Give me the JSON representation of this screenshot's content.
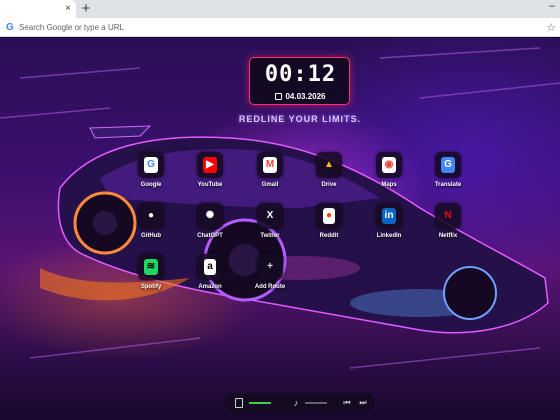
{
  "browser": {
    "tab_close": "×",
    "new_tab": "+",
    "window_minimize": "–",
    "omnibox_placeholder": "Search Google or type a URL",
    "google_g": "G",
    "bookmark_star": "☆"
  },
  "clock": {
    "time": "00:12",
    "date": "04.03.2026"
  },
  "tagline": "REDLINE YOUR LIMITS.",
  "shortcuts": [
    {
      "label": "Google",
      "glyph": "G",
      "icon": "google-icon",
      "color": "#4285f4",
      "bg": "#ffffff"
    },
    {
      "label": "YouTube",
      "glyph": "▶",
      "icon": "youtube-icon",
      "color": "#ffffff",
      "bg": "#ff0000"
    },
    {
      "label": "Gmail",
      "glyph": "M",
      "icon": "gmail-icon",
      "color": "#ea4335",
      "bg": "#ffffff"
    },
    {
      "label": "Drive",
      "glyph": "▲",
      "icon": "drive-icon",
      "color": "#fbbc04",
      "bg": "transparent"
    },
    {
      "label": "Maps",
      "glyph": "◉",
      "icon": "maps-icon",
      "color": "#ea4335",
      "bg": "#ffffff"
    },
    {
      "label": "Translate",
      "glyph": "G",
      "icon": "translate-icon",
      "color": "#ffffff",
      "bg": "#4285f4"
    },
    {
      "label": "GitHub",
      "glyph": "●",
      "icon": "github-icon",
      "color": "#ffffff",
      "bg": "transparent"
    },
    {
      "label": "ChatGPT",
      "glyph": "✺",
      "icon": "chatgpt-icon",
      "color": "#ffffff",
      "bg": "transparent"
    },
    {
      "label": "Twitter",
      "glyph": "X",
      "icon": "x-icon",
      "color": "#ffffff",
      "bg": "transparent"
    },
    {
      "label": "Reddit",
      "glyph": "●",
      "icon": "reddit-icon",
      "color": "#ff4500",
      "bg": "#ffffff"
    },
    {
      "label": "LinkedIn",
      "glyph": "in",
      "icon": "linkedin-icon",
      "color": "#ffffff",
      "bg": "#0a66c2"
    },
    {
      "label": "Netflix",
      "glyph": "N",
      "icon": "netflix-icon",
      "color": "#e50914",
      "bg": "transparent"
    },
    {
      "label": "Spotify",
      "glyph": "≋",
      "icon": "spotify-icon",
      "color": "#000000",
      "bg": "#1ed760"
    },
    {
      "label": "Amazon",
      "glyph": "a",
      "icon": "amazon-icon",
      "color": "#000000",
      "bg": "#ffffff"
    },
    {
      "label": "Add Route",
      "glyph": "+",
      "icon": "plus-icon",
      "color": "#e0e0e0",
      "bg": "transparent"
    }
  ],
  "media": {
    "volume_glyph": "♪",
    "prev_glyph": "⏮",
    "next_glyph": "⏭"
  }
}
